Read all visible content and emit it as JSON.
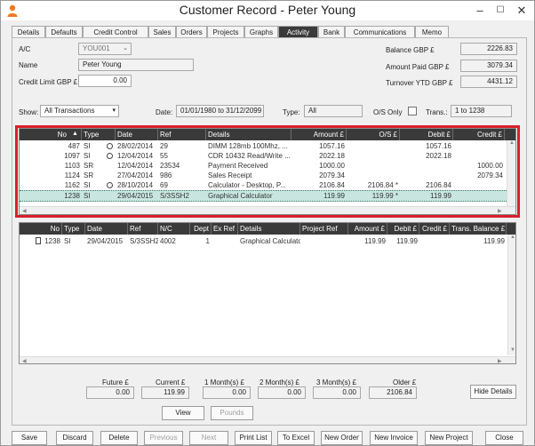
{
  "window": {
    "title": "Customer Record - Peter Young",
    "minimize": "–",
    "maximize": "☐",
    "close": "✕"
  },
  "tabs": [
    "Details",
    "Defaults",
    "Credit Control",
    "Sales",
    "Orders",
    "Projects",
    "Graphs",
    "Activity",
    "Bank",
    "Communications",
    "Memo"
  ],
  "active_tab": "Activity",
  "header": {
    "ac_label": "A/C",
    "ac_value": "YOU001",
    "name_label": "Name",
    "name_value": "Peter Young",
    "credit_label": "Credit Limit GBP £",
    "credit_value": "0.00",
    "balance_label": "Balance GBP £",
    "balance_value": "2226.83",
    "paid_label": "Amount Paid GBP £",
    "paid_value": "3079.34",
    "turnover_label": "Turnover YTD GBP £",
    "turnover_value": "4431.12"
  },
  "filters": {
    "show_label": "Show:",
    "show_value": "All Transactions",
    "date_label": "Date:",
    "date_value": "01/01/1980 to 31/12/2099",
    "type_label": "Type:",
    "type_value": "All",
    "os_label": "O/S Only",
    "trans_label": "Trans.:",
    "trans_value": "1 to 1238"
  },
  "top_grid": {
    "headers": [
      "No",
      "Type",
      "Date",
      "Ref",
      "Details",
      "Amount £",
      "O/S £",
      "Debit £",
      "Credit £"
    ],
    "rows": [
      {
        "no": "487",
        "type": "SI",
        "clock": true,
        "date": "28/02/2014",
        "ref": "29",
        "details": "DIMM 128mb 100Mhz, ...",
        "amount": "1057.16",
        "os": "",
        "debit": "1057.16",
        "credit": ""
      },
      {
        "no": "1097",
        "type": "SI",
        "clock": true,
        "date": "12/04/2014",
        "ref": "55",
        "details": "CDR 10432 Read/Write ...",
        "amount": "2022.18",
        "os": "",
        "debit": "2022.18",
        "credit": ""
      },
      {
        "no": "1103",
        "type": "SR",
        "clock": false,
        "date": "12/04/2014",
        "ref": "23534",
        "details": "Payment Received",
        "amount": "1000.00",
        "os": "",
        "debit": "",
        "credit": "1000.00"
      },
      {
        "no": "1124",
        "type": "SR",
        "clock": false,
        "date": "27/04/2014",
        "ref": "986",
        "details": "Sales Receipt",
        "amount": "2079.34",
        "os": "",
        "debit": "",
        "credit": "2079.34"
      },
      {
        "no": "1162",
        "type": "SI",
        "clock": true,
        "date": "28/10/2014",
        "ref": "69",
        "details": "Calculator - Desktop, P...",
        "amount": "2106.84",
        "os": "2106.84 *",
        "debit": "2106.84",
        "credit": ""
      },
      {
        "no": "1238",
        "type": "SI",
        "clock": false,
        "date": "29/04/2015",
        "ref": "S/3SSH2",
        "details": "Graphical Calculator",
        "amount": "119.99",
        "os": "119.99 *",
        "debit": "119.99",
        "credit": ""
      }
    ]
  },
  "bottom_grid": {
    "headers": [
      "No",
      "Type",
      "Date",
      "Ref",
      "N/C",
      "Dept",
      "Ex Ref",
      "Details",
      "Project Ref",
      "Amount £",
      "Debit £",
      "Credit £",
      "Trans. Balance £"
    ],
    "rows": [
      {
        "no": "1238",
        "type": "SI",
        "date": "29/04/2015",
        "ref": "S/3SSH2",
        "nc": "4002",
        "dept": "1",
        "exref": "",
        "details": "Graphical Calculator",
        "projref": "",
        "amount": "119.99",
        "debit": "119.99",
        "credit": "",
        "balance": "119.99"
      }
    ]
  },
  "aged": [
    {
      "label": "Future £",
      "value": "0.00"
    },
    {
      "label": "Current £",
      "value": "119.99"
    },
    {
      "label": "1 Month(s) £",
      "value": "0.00"
    },
    {
      "label": "2 Month(s) £",
      "value": "0.00"
    },
    {
      "label": "3 Month(s) £",
      "value": "0.00"
    },
    {
      "label": "Older £",
      "value": "2106.84"
    }
  ],
  "buttons": {
    "hide_details": "Hide Details",
    "view": "View",
    "pounds": "Pounds",
    "save": "Save",
    "discard": "Discard",
    "delete": "Delete",
    "previous": "Previous",
    "next": "Next",
    "print_list": "Print List",
    "to_excel": "To Excel",
    "new_order": "New Order",
    "new_invoice": "New Invoice",
    "new_project": "New Project",
    "close": "Close"
  },
  "colors": {
    "header_dark": "#3a3a3a",
    "selected_row": "#c8e6df",
    "highlight_border": "#d9202a",
    "app_icon": "#f07a22"
  }
}
